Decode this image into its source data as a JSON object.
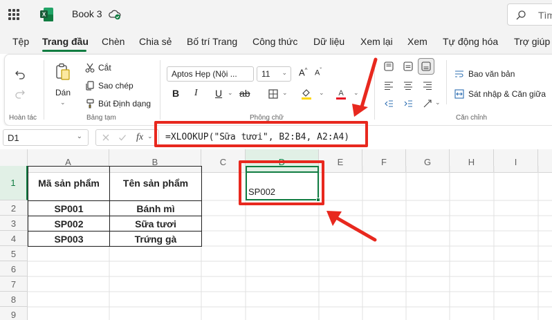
{
  "app": {
    "title": "Book 3",
    "search_placeholder": "Tìm"
  },
  "tabs": [
    "Tệp",
    "Trang đầu",
    "Chèn",
    "Chia sẻ",
    "Bố trí Trang",
    "Công thức",
    "Dữ liệu",
    "Xem lại",
    "Xem",
    "Tự động hóa",
    "Trợ giúp"
  ],
  "active_tab": "Trang đầu",
  "ribbon": {
    "undo_group_label": "Hoàn tác",
    "paste_label": "Dán",
    "cut_label": "Cắt",
    "copy_label": "Sao chép",
    "format_painter_label": "Bút Định dạng",
    "clipboard_group_label": "Bảng tạm",
    "font_name": "Aptos Hẹp (Nội ...",
    "font_size": "11",
    "bold_label": "B",
    "italic_label": "I",
    "underline_label": "U",
    "font_group_label": "Phông chữ",
    "wrap_text_label": "Bao văn bản",
    "merge_center_label": "Sát nhập & Căn giữa",
    "alignment_group_label": "Căn chỉnh",
    "fill_color": "#ffd700",
    "font_color": "#e81123"
  },
  "formula_bar": {
    "name_box": "D1",
    "fx_label": "fx",
    "formula": "=XLOOKUP(\"Sữa tươi\", B2:B4, A2:A4)"
  },
  "sheet": {
    "columns": [
      "A",
      "B",
      "C",
      "D",
      "E",
      "F",
      "G",
      "H",
      "I"
    ],
    "rows": [
      "1",
      "2",
      "3",
      "4",
      "5",
      "6",
      "7",
      "8",
      "9"
    ],
    "selected_column": "D",
    "selected_row": "1",
    "table_headers": [
      "Mã sản phẩm",
      "Tên sản phẩm"
    ],
    "table_rows": [
      [
        "SP001",
        "Bánh mì"
      ],
      [
        "SP002",
        "Sữa tươi"
      ],
      [
        "SP003",
        "Trứng gà"
      ]
    ],
    "active_cell_value": "SP002"
  },
  "colors": {
    "accent": "#107c41",
    "highlight": "#e8281e"
  }
}
